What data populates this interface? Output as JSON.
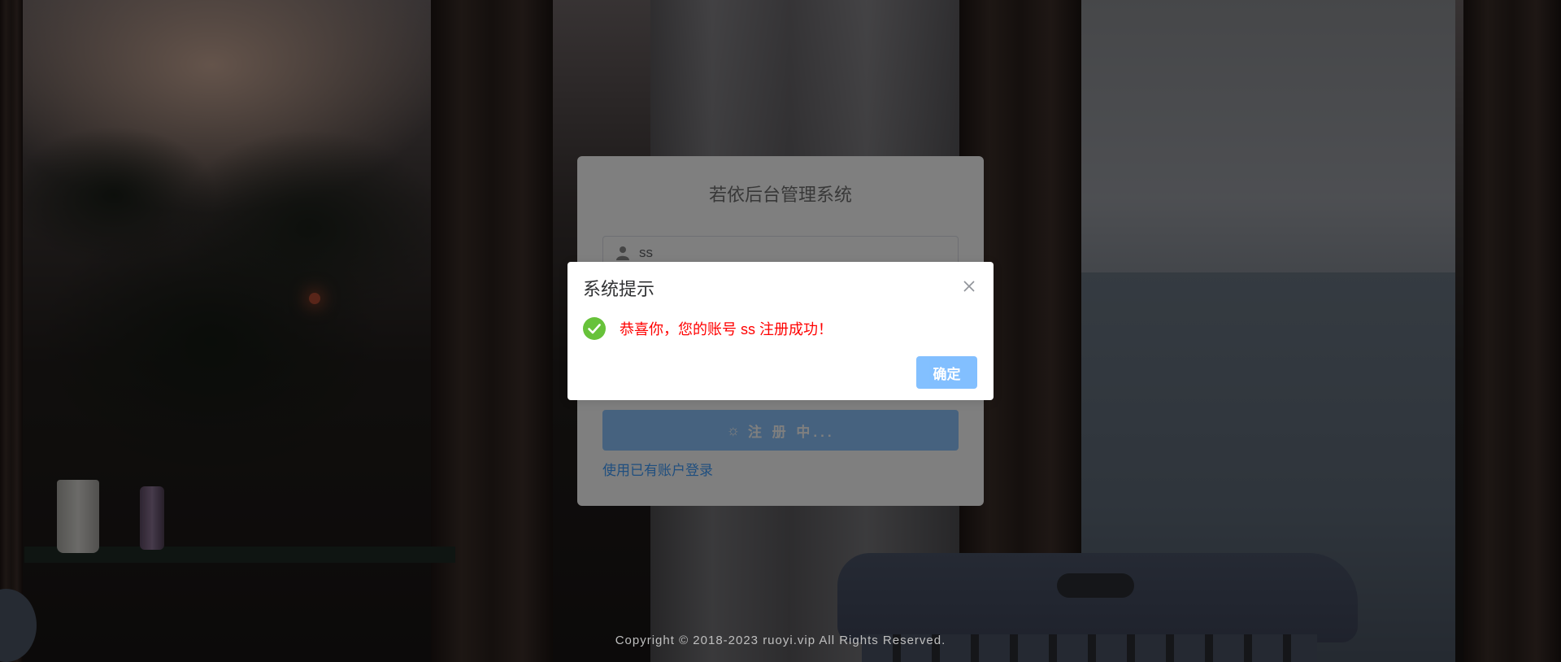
{
  "register_form": {
    "title": "若依后台管理系统",
    "username_value": "ss",
    "register_button_label": "注 册 中...",
    "login_link_label": "使用已有账户登录"
  },
  "dialog": {
    "title": "系统提示",
    "message": "恭喜你，您的账号 ss 注册成功！",
    "confirm_label": "确定",
    "status_icon": "success-check-icon",
    "success_color": "#67c23a",
    "message_color": "#ff0000"
  },
  "footer": {
    "copyright": "Copyright © 2018-2023 ruoyi.vip All Rights Reserved."
  },
  "theme": {
    "primary": "#409eff",
    "overlay": "rgba(0,0,0,0.5)"
  }
}
